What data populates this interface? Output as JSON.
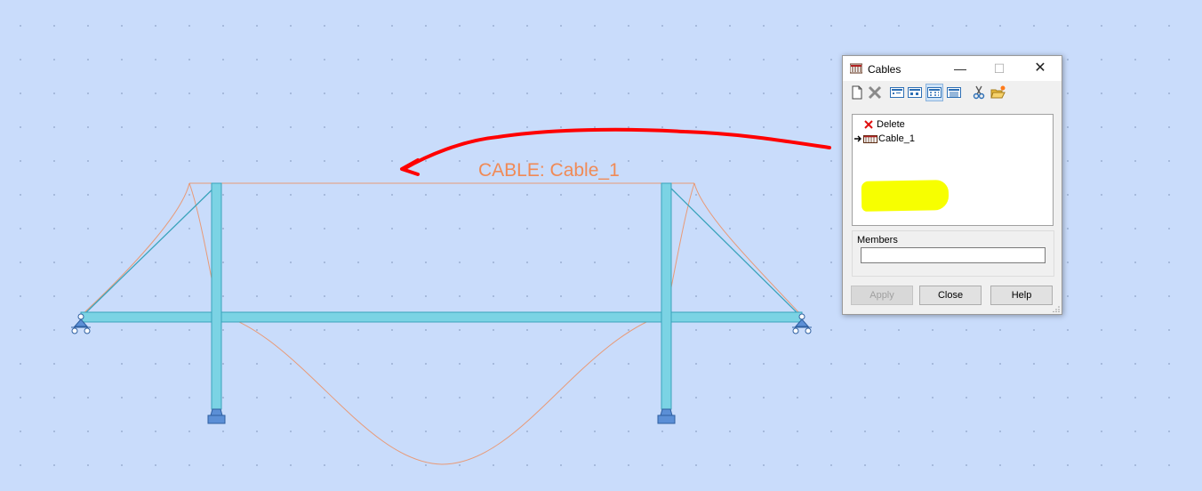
{
  "canvas": {
    "annotation_label": "CABLE: Cable_1",
    "colors": {
      "background": "#c9dcfb",
      "member": "#7bd3e4",
      "member_edge": "#3aa3bb",
      "cable": "#f08a56",
      "annotation_arrow": "#ff0000",
      "support": "#5b8fd6"
    },
    "icons": [
      "pin-support-icon",
      "fixed-support-icon",
      "roller-support-icon"
    ]
  },
  "dialog": {
    "title": "Cables",
    "window_buttons": {
      "minimize": "—",
      "maximize": "☐",
      "close": "✕"
    },
    "toolbar": [
      {
        "name": "new-icon",
        "active": false
      },
      {
        "name": "delete-icon",
        "active": false
      },
      {
        "name": "view-small-icons-icon",
        "active": false
      },
      {
        "name": "view-large-icons-icon",
        "active": false
      },
      {
        "name": "view-list-icon",
        "active": true
      },
      {
        "name": "view-details-icon",
        "active": false
      },
      {
        "name": "cut-icon",
        "active": false
      },
      {
        "name": "open-folder-icon",
        "active": false
      }
    ],
    "list": {
      "items": [
        {
          "label": "Delete",
          "icon": "red-x-icon"
        },
        {
          "label": "Cable_1",
          "icon": "cable-icon",
          "selected": true,
          "highlight_color": "#f7ff00"
        }
      ]
    },
    "members": {
      "label": "Members",
      "value": ""
    },
    "buttons": {
      "apply": "Apply",
      "close": "Close",
      "help": "Help"
    }
  }
}
